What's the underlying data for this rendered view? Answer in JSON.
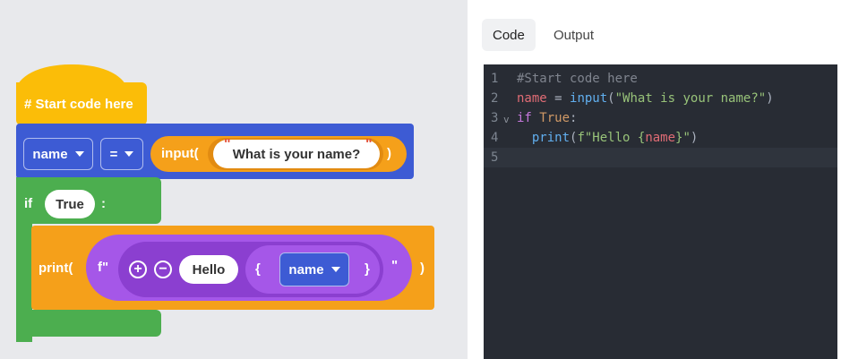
{
  "blocks": {
    "hat_label": "# Start code here",
    "assign": {
      "variable": "name",
      "operator": "=",
      "input_label": "input(",
      "prompt_text": "What is your name?",
      "close_paren": ")"
    },
    "if_block": {
      "keyword": "if",
      "condition": "True",
      "colon": ":"
    },
    "print_block": {
      "label": "print(",
      "fstring_prefix": "f\"",
      "plus_symbol": "+",
      "minus_symbol": "−",
      "text": "Hello",
      "open_brace": "{",
      "variable": "name",
      "close_brace": "}",
      "close_quote": "\"",
      "close_paren": ")"
    }
  },
  "tabs": {
    "code": "Code",
    "output": "Output",
    "active": "code"
  },
  "editor": {
    "active_line": 5,
    "lines": [
      {
        "number": "1",
        "tokens": [
          {
            "t": "#Start code here",
            "c": "comment"
          }
        ]
      },
      {
        "number": "2",
        "tokens": [
          {
            "t": "name",
            "c": "var"
          },
          {
            "t": " = ",
            "c": "op"
          },
          {
            "t": "input",
            "c": "fn"
          },
          {
            "t": "(",
            "c": "plain"
          },
          {
            "t": "\"What is your name?\"",
            "c": "str"
          },
          {
            "t": ")",
            "c": "plain"
          }
        ]
      },
      {
        "number": "3",
        "fold": "v",
        "tokens": [
          {
            "t": "if",
            "c": "kw"
          },
          {
            "t": " ",
            "c": "plain"
          },
          {
            "t": "True",
            "c": "const"
          },
          {
            "t": ":",
            "c": "plain"
          }
        ]
      },
      {
        "number": "4",
        "tokens": [
          {
            "t": "  ",
            "c": "plain"
          },
          {
            "t": "print",
            "c": "fn"
          },
          {
            "t": "(",
            "c": "plain"
          },
          {
            "t": "f\"Hello {",
            "c": "str"
          },
          {
            "t": "name",
            "c": "var"
          },
          {
            "t": "}\"",
            "c": "str"
          },
          {
            "t": ")",
            "c": "plain"
          }
        ]
      },
      {
        "number": "5",
        "tokens": []
      }
    ]
  },
  "colors": {
    "event_block": "#fbbd08",
    "variable_block": "#3d5bd4",
    "io_block": "#f5a01a",
    "control_block": "#4cae4f",
    "text_block": "#a557e8",
    "editor_background": "#282c34"
  }
}
